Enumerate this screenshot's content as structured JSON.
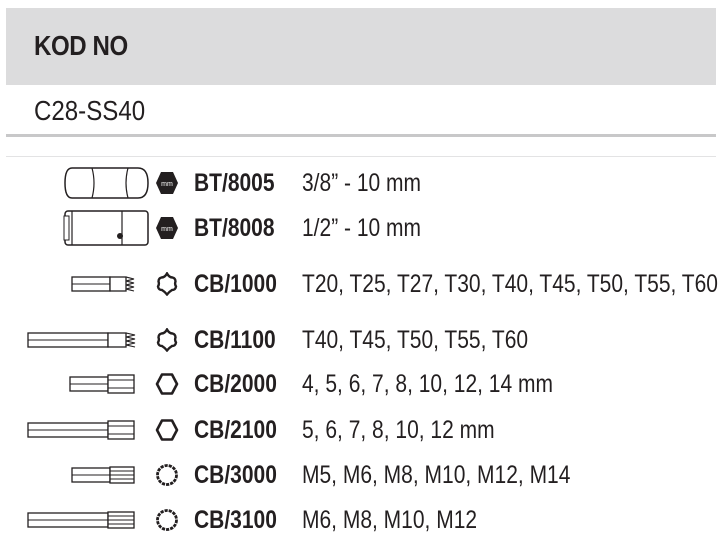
{
  "header": {
    "title": "KOD NO"
  },
  "kit": {
    "code": "C28-SS40"
  },
  "rows": [
    {
      "code": "BT/8005",
      "sizes": "3/8” - 10 mm",
      "type_icon": "hex-socket-mm-icon",
      "tool_icon": "socket-small-icon"
    },
    {
      "code": "BT/8008",
      "sizes": "1/2” - 10 mm",
      "type_icon": "hex-socket-mm-icon",
      "tool_icon": "socket-large-icon"
    },
    {
      "code": "CB/1000",
      "sizes": "T20, T25, T27, T30, T40, T45, T50, T55, T60",
      "type_icon": "torx-icon",
      "tool_icon": "torx-bit-short-icon"
    },
    {
      "code": "CB/1100",
      "sizes": "T40, T45, T50, T55, T60",
      "type_icon": "torx-icon",
      "tool_icon": "torx-bit-long-icon"
    },
    {
      "code": "CB/2000",
      "sizes": "4, 5, 6, 7, 8, 10, 12, 14 mm",
      "type_icon": "hex-icon",
      "tool_icon": "hex-bit-short-icon"
    },
    {
      "code": "CB/2100",
      "sizes": "5, 6, 7, 8, 10, 12 mm",
      "type_icon": "hex-icon",
      "tool_icon": "hex-bit-long-icon"
    },
    {
      "code": "CB/3000",
      "sizes": "M5, M6, M8, M10, M12, M14",
      "type_icon": "spline-icon",
      "tool_icon": "spline-bit-short-icon"
    },
    {
      "code": "CB/3100",
      "sizes": "M6, M8, M10, M12",
      "type_icon": "spline-icon",
      "tool_icon": "spline-bit-long-icon"
    }
  ],
  "mm_badge": "mm"
}
